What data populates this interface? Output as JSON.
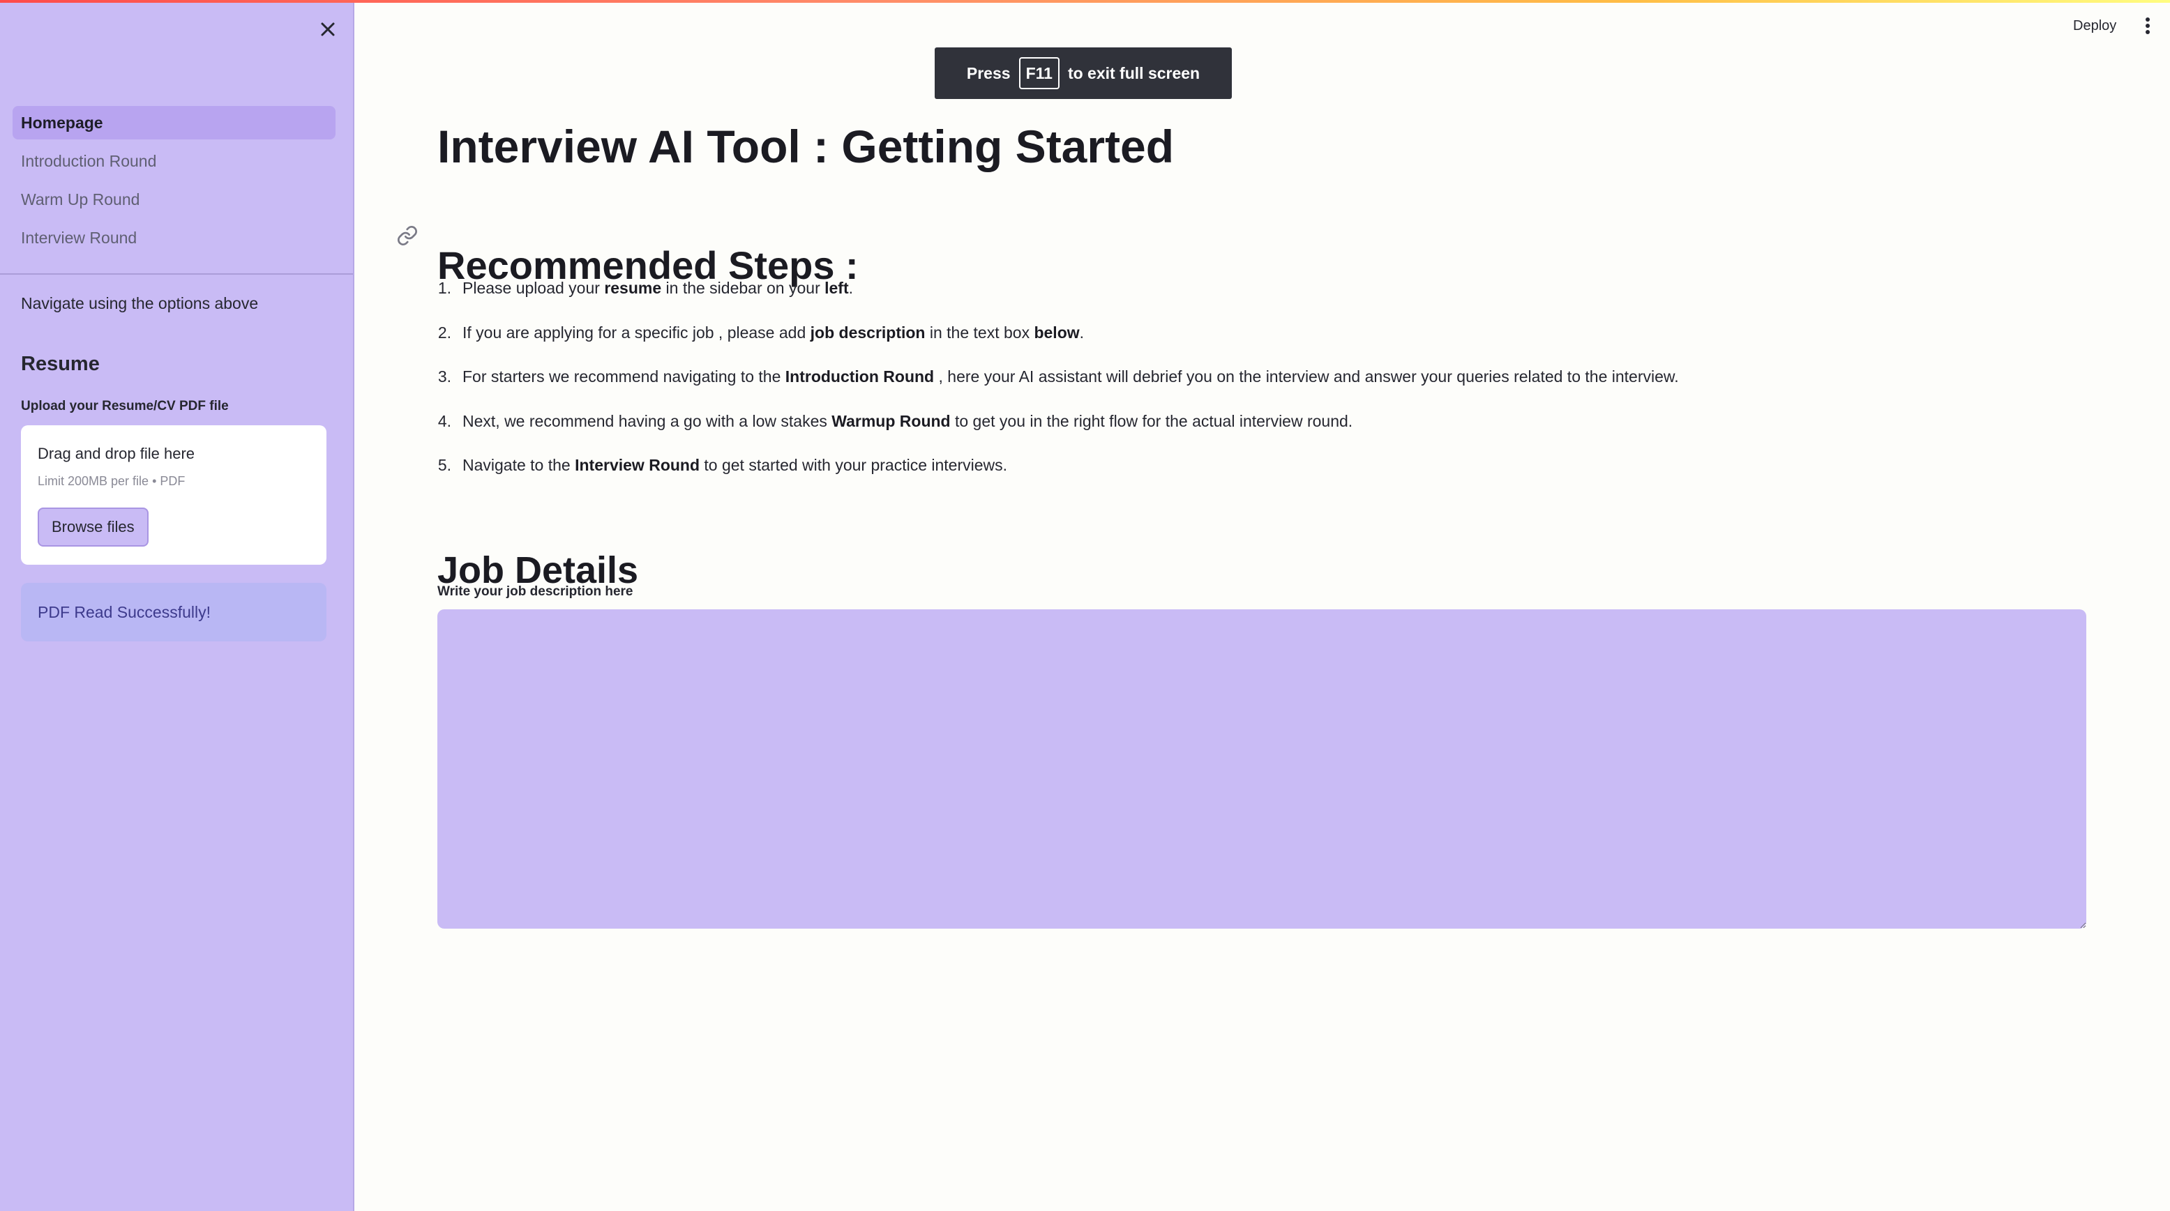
{
  "sidebar": {
    "nav_items": [
      {
        "label": "Homepage",
        "active": true
      },
      {
        "label": "Introduction Round",
        "active": false
      },
      {
        "label": "Warm Up Round",
        "active": false
      },
      {
        "label": "Interview Round",
        "active": false
      }
    ],
    "nav_hint": "Navigate using the options above",
    "resume_heading": "Resume",
    "upload_label": "Upload your Resume/CV PDF file",
    "dropzone": {
      "title": "Drag and drop file here",
      "limit": "Limit 200MB per file • PDF",
      "browse_label": "Browse files"
    },
    "success_message": "PDF Read Successfully!"
  },
  "header": {
    "deploy_label": "Deploy",
    "menu_icon": "vertical-ellipsis-icon"
  },
  "fullscreen_toast": {
    "prefix": "Press",
    "key": "F11",
    "suffix": "to exit full screen"
  },
  "main": {
    "title": "Interview AI Tool : Getting Started",
    "steps_heading": "Recommended Steps :",
    "steps": [
      {
        "num": "1.",
        "parts": [
          {
            "text": "Please upload your "
          },
          {
            "text": "resume",
            "bold": true
          },
          {
            "text": " in the sidebar on your "
          },
          {
            "text": "left",
            "bold": true
          },
          {
            "text": "."
          }
        ]
      },
      {
        "num": "2.",
        "parts": [
          {
            "text": "If you are applying for a specific job , please add "
          },
          {
            "text": "job description",
            "bold": true
          },
          {
            "text": " in the text box "
          },
          {
            "text": "below",
            "bold": true
          },
          {
            "text": "."
          }
        ]
      },
      {
        "num": "3.",
        "parts": [
          {
            "text": "For starters we recommend navigating to the "
          },
          {
            "text": "Introduction Round",
            "bold": true
          },
          {
            "text": " , here your AI assistant will debrief you on the interview and answer your queries related to the interview."
          }
        ]
      },
      {
        "num": "4.",
        "parts": [
          {
            "text": "Next, we recommend having a go with a low stakes "
          },
          {
            "text": "Warmup Round",
            "bold": true
          },
          {
            "text": " to get you in the right flow for the actual interview round."
          }
        ]
      },
      {
        "num": "5.",
        "parts": [
          {
            "text": "Navigate to the "
          },
          {
            "text": "Interview Round",
            "bold": true
          },
          {
            "text": " to get started with your practice interviews."
          }
        ]
      }
    ],
    "job_heading": "Job Details",
    "jd_label": "Write your job description here",
    "jd_value": ""
  },
  "colors": {
    "sidebar_bg": "#c9bbf5",
    "nav_active_bg": "#b8a4f0",
    "success_bg": "#b9b7f4",
    "textarea_bg": "#c9bbf5",
    "page_bg": "#fdfdfa",
    "toast_bg": "#30323a"
  }
}
